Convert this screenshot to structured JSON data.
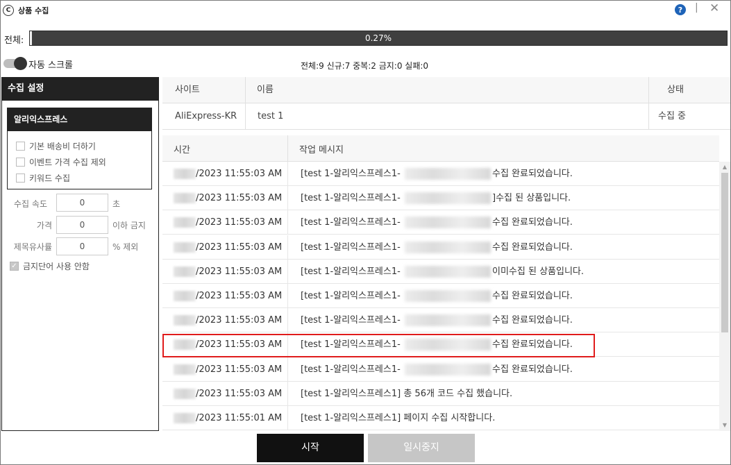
{
  "window": {
    "title": "상품 수집",
    "help_symbol": "?",
    "minimize_symbol": "|",
    "close_symbol": "✕"
  },
  "progress": {
    "label": "전체:",
    "value_text": "0.27%",
    "fraction": 0.0027
  },
  "auto_scroll": {
    "label": "자동 스크롤",
    "enabled": true
  },
  "stats": "전체:9 신규:7 중복:2 금지:0 실패:0",
  "settings": {
    "header": "수집 설정",
    "group_title": "알리익스프레스",
    "options": [
      {
        "label": "기본 배송비 더하기",
        "checked": false
      },
      {
        "label": "이벤트 가격 수집 제외",
        "checked": false
      },
      {
        "label": "키워드 수집",
        "checked": false
      }
    ],
    "speed": {
      "label": "수집 속도",
      "value": "0",
      "suffix": "초"
    },
    "price": {
      "label": "가격",
      "value": "0",
      "suffix": "이하 금지"
    },
    "similarity": {
      "label": "제목유사률",
      "value": "0",
      "suffix": "% 제외"
    },
    "banned_words": {
      "label": "금지단어 사용 안함",
      "checked": true
    }
  },
  "site_table": {
    "headers": {
      "site": "사이트",
      "name": "이름",
      "status": "상태"
    },
    "row": {
      "site": "AliExpress-KR",
      "name": "test 1",
      "status": "수집 중"
    }
  },
  "log_table": {
    "headers": {
      "time": "시간",
      "message": "작업 메시지"
    },
    "rows": [
      {
        "time": "/2023 11:55:03 AM",
        "prefix": "[test 1-알리익스프레스1-",
        "suffix": "수집 완료되었습니다.",
        "redacted": true
      },
      {
        "time": "/2023 11:55:03 AM",
        "prefix": "[test 1-알리익스프레스1-",
        "suffix": "]수집 된 상품입니다.",
        "redacted": true
      },
      {
        "time": "/2023 11:55:03 AM",
        "prefix": "[test 1-알리익스프레스1-",
        "suffix": "수집 완료되었습니다.",
        "redacted": true
      },
      {
        "time": "/2023 11:55:03 AM",
        "prefix": "[test 1-알리익스프레스1-",
        "suffix": "수집 완료되었습니다.",
        "redacted": true
      },
      {
        "time": "/2023 11:55:03 AM",
        "prefix": "[test 1-알리익스프레스1-",
        "suffix": "이미수집 된 상품입니다.",
        "redacted": true
      },
      {
        "time": "/2023 11:55:03 AM",
        "prefix": "[test 1-알리익스프레스1-",
        "suffix": "수집 완료되었습니다.",
        "redacted": true
      },
      {
        "time": "/2023 11:55:03 AM",
        "prefix": "[test 1-알리익스프레스1-",
        "suffix": "수집 완료되었습니다.",
        "redacted": true
      },
      {
        "time": "/2023 11:55:03 AM",
        "prefix": "[test 1-알리익스프레스1-",
        "suffix": "수집 완료되었습니다.",
        "redacted": true,
        "highlighted": true
      },
      {
        "time": "/2023 11:55:03 AM",
        "prefix": "[test 1-알리익스프레스1-",
        "suffix": "수집 완료되었습니다.",
        "redacted": true
      },
      {
        "time": "/2023 11:55:03 AM",
        "prefix": "[test 1-알리익스프레스1] 총 56개 코드 수집 했습니다.",
        "suffix": "",
        "redacted": false
      },
      {
        "time": "/2023 11:55:01 AM",
        "prefix": "[test 1-알리익스프레스1] 페이지 수집 시작합니다.",
        "suffix": "",
        "redacted": false
      }
    ]
  },
  "buttons": {
    "start": "시작",
    "pause": "일시중지"
  },
  "colors": {
    "highlight": "#e01b1b",
    "help_icon": "#1e63b8",
    "header_dark": "#222222"
  }
}
